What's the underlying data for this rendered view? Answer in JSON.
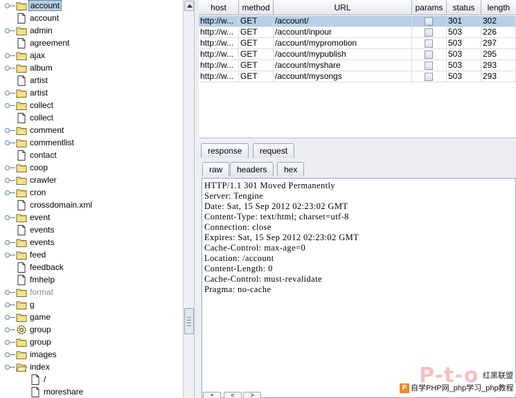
{
  "tree": {
    "items": [
      {
        "label": "account",
        "type": "folder",
        "expandable": true,
        "selected": true
      },
      {
        "label": "account",
        "type": "file"
      },
      {
        "label": "admin",
        "type": "folder",
        "expandable": true
      },
      {
        "label": "agreement",
        "type": "file"
      },
      {
        "label": "ajax",
        "type": "folder",
        "expandable": true
      },
      {
        "label": "album",
        "type": "folder",
        "expandable": true
      },
      {
        "label": "artist",
        "type": "file"
      },
      {
        "label": "artist",
        "type": "folder",
        "expandable": true
      },
      {
        "label": "collect",
        "type": "folder",
        "expandable": true
      },
      {
        "label": "collect",
        "type": "file"
      },
      {
        "label": "comment",
        "type": "folder",
        "expandable": true
      },
      {
        "label": "commentlist",
        "type": "folder",
        "expandable": true
      },
      {
        "label": "contact",
        "type": "file"
      },
      {
        "label": "coop",
        "type": "folder",
        "expandable": true
      },
      {
        "label": "crawler",
        "type": "folder",
        "expandable": true
      },
      {
        "label": "cron",
        "type": "folder",
        "expandable": true
      },
      {
        "label": "crossdomain.xml",
        "type": "file"
      },
      {
        "label": "event",
        "type": "folder",
        "expandable": true
      },
      {
        "label": "events",
        "type": "file"
      },
      {
        "label": "events",
        "type": "folder",
        "expandable": true
      },
      {
        "label": "feed",
        "type": "folder",
        "expandable": true
      },
      {
        "label": "feedback",
        "type": "file"
      },
      {
        "label": "fmhelp",
        "type": "file"
      },
      {
        "label": "format",
        "type": "folder",
        "expandable": true,
        "dim": true
      },
      {
        "label": "g",
        "type": "folder",
        "expandable": true
      },
      {
        "label": "game",
        "type": "folder",
        "expandable": true
      },
      {
        "label": "group",
        "type": "gear",
        "expandable": true
      },
      {
        "label": "group",
        "type": "folder",
        "expandable": true
      },
      {
        "label": "images",
        "type": "folder",
        "expandable": true
      },
      {
        "label": "index",
        "type": "folder-open",
        "expandable": true
      },
      {
        "label": "/",
        "type": "file",
        "indent": true
      },
      {
        "label": "moreshare",
        "type": "file",
        "indent": true
      }
    ]
  },
  "table": {
    "columns": [
      "host",
      "method",
      "URL",
      "params",
      "status",
      "length"
    ],
    "rows": [
      {
        "host": "http://w...",
        "method": "GET",
        "url": "/account/",
        "status": "301",
        "length": "302"
      },
      {
        "host": "http://w...",
        "method": "GET",
        "url": "/account/inpour",
        "status": "503",
        "length": "226"
      },
      {
        "host": "http://w...",
        "method": "GET",
        "url": "/account/mypromotion",
        "status": "503",
        "length": "297"
      },
      {
        "host": "http://w...",
        "method": "GET",
        "url": "/account/mypublish",
        "status": "503",
        "length": "295"
      },
      {
        "host": "http://w...",
        "method": "GET",
        "url": "/account/myshare",
        "status": "503",
        "length": "293"
      },
      {
        "host": "http://w...",
        "method": "GET",
        "url": "/account/mysongs",
        "status": "503",
        "length": "293"
      }
    ]
  },
  "tabs": {
    "outer": [
      "response",
      "request"
    ],
    "inner": [
      "raw",
      "headers",
      "hex"
    ]
  },
  "response_lines": [
    "HTTP/1.1 301 Moved Permanently",
    "Server: Tengine",
    "Date: Sat, 15 Sep 2012 02:23:02 GMT",
    "Content-Type: text/html; charset=utf-8",
    "Connection: close",
    "Expires: Sat, 15 Sep 2012 02:23:02 GMT",
    "Cache-Control: max-age=0",
    "Location: /account",
    "Content-Length: 0",
    "Cache-Control: must-revalidate",
    "Pragma: no-cache"
  ],
  "bottom_buttons": [
    "+",
    "<",
    ">"
  ],
  "watermark": {
    "logo": "P-t-o",
    "side": "红黑联盟",
    "strip_icon": "P",
    "strip": "自学PHP网_php学习_php教程"
  },
  "colors": {
    "selection": "#b8cfe5",
    "folder": "#f3e28a",
    "watermark_red": "#e84c4c"
  }
}
